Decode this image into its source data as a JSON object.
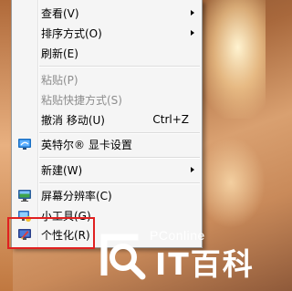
{
  "context_menu": {
    "items": [
      {
        "label": "查看(V)",
        "submenu": true
      },
      {
        "label": "排序方式(O)",
        "submenu": true
      },
      {
        "label": "刷新(E)"
      },
      {
        "label": "粘贴(P)",
        "disabled": true
      },
      {
        "label": "粘贴快捷方式(S)",
        "disabled": true
      },
      {
        "label": "撤消 移动(U)",
        "shortcut": "Ctrl+Z"
      },
      {
        "label": "英特尔® 显卡设置",
        "icon": "intel-graphics-icon"
      },
      {
        "label": "新建(W)",
        "submenu": true
      },
      {
        "label": "屏幕分辨率(C)",
        "icon": "screen-resolution-icon"
      },
      {
        "label": "小工具(G)",
        "icon": "gadgets-icon"
      },
      {
        "label": "个性化(R)",
        "icon": "personalize-icon"
      }
    ]
  },
  "highlight": {
    "target": "个性化(R)",
    "color": "#e02020"
  },
  "watermark": {
    "brand": "PConline",
    "chinese_name": "IT百科",
    "logo": "pconline-magnifier-logo",
    "color": "#ffffff"
  }
}
